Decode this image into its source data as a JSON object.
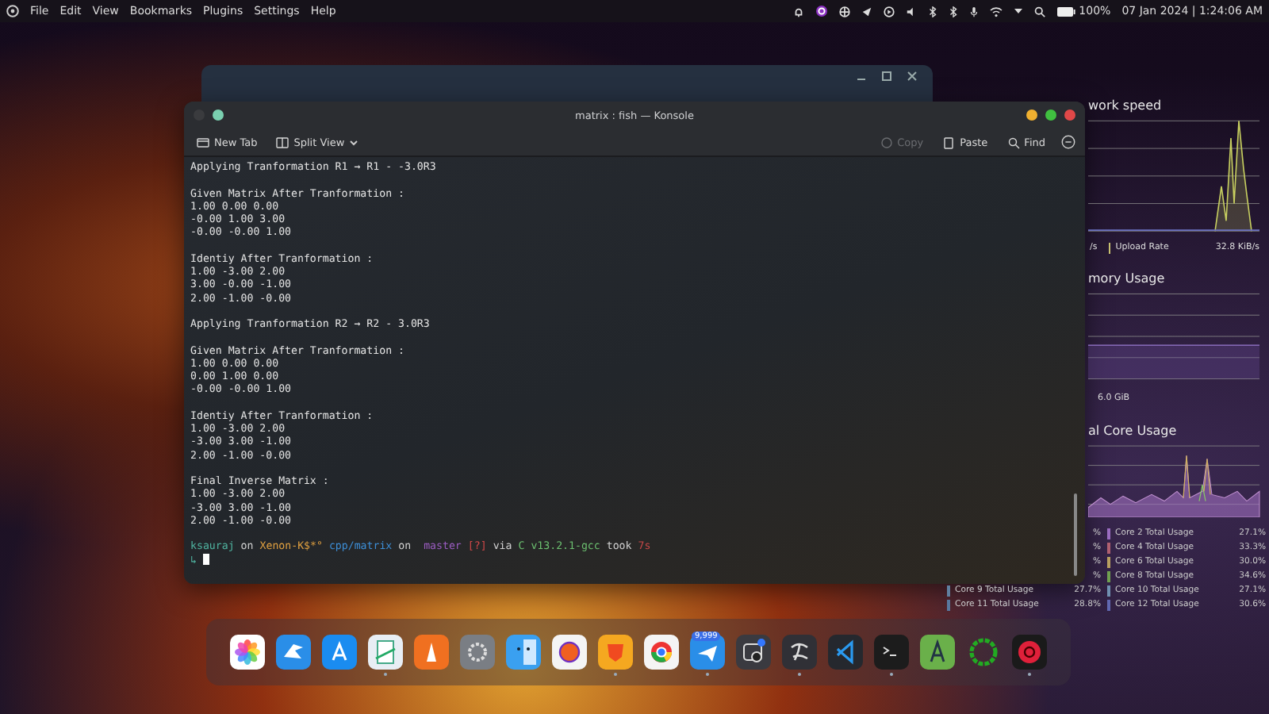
{
  "top_bar": {
    "menus": [
      "File",
      "Edit",
      "View",
      "Bookmarks",
      "Plugins",
      "Settings",
      "Help"
    ],
    "battery": "100%",
    "clock": "07 Jan 2024 | 1:24:06 AM"
  },
  "konsole": {
    "title": "matrix : fish — Konsole",
    "toolbar_left": [
      {
        "label": "New Tab",
        "kind": "tab"
      },
      {
        "label": "Split View",
        "kind": "split"
      }
    ],
    "toolbar_right": [
      {
        "label": "Copy",
        "kind": "copy",
        "disabled": true
      },
      {
        "label": "Paste",
        "kind": "paste",
        "disabled": false
      },
      {
        "label": "Find",
        "kind": "find",
        "disabled": false
      }
    ],
    "output": [
      [
        "Applying Tranformation R1 → R1 - -3.0R3"
      ],
      [
        "Given Matrix After Tranformation :",
        "1.00 0.00 0.00",
        "-0.00 1.00 3.00",
        "-0.00 -0.00 1.00"
      ],
      [
        "Identiy After Tranformation :",
        "1.00 -3.00 2.00",
        "3.00 -0.00 -1.00",
        "2.00 -1.00 -0.00"
      ],
      [
        "Applying Tranformation R2 → R2 - 3.0R3"
      ],
      [
        "Given Matrix After Tranformation :",
        "1.00 0.00 0.00",
        "0.00 1.00 0.00",
        "-0.00 -0.00 1.00"
      ],
      [
        "Identiy After Tranformation :",
        "1.00 -3.00 2.00",
        "-3.00 3.00 -1.00",
        "2.00 -1.00 -0.00"
      ],
      [
        "Final Inverse Matrix :",
        "1.00 -3.00 2.00",
        "-3.00 3.00 -1.00",
        "2.00 -1.00 -0.00"
      ]
    ],
    "prompt": [
      {
        "text": "ksauraj",
        "color": "#4fb3a0"
      },
      {
        "text": "on",
        "color": "#d0d0d0"
      },
      {
        "text": "Xenon-K$*°",
        "color": "#e0a040"
      },
      {
        "text": "cpp/matrix",
        "color": "#3d8fd8"
      },
      {
        "text": "on",
        "color": "#d0d0d0"
      },
      {
        "text": " master",
        "color": "#9a5cc0"
      },
      {
        "text": "[?]",
        "color": "#d04848"
      },
      {
        "text": "via",
        "color": "#d0d0d0"
      },
      {
        "text": "C v13.2.1-gcc",
        "color": "#6cc070"
      },
      {
        "text": "took",
        "color": "#d0d0d0"
      },
      {
        "text": "7s",
        "color": "#c84848"
      }
    ],
    "prompt_arrow": "↳"
  },
  "monitor": {
    "network_title": "work speed",
    "download_rate": "/s",
    "upload_label": "Upload Rate",
    "upload_rate": "32.8 KiB/s",
    "memory_title": "mory Usage",
    "memory_value": "6.0 GiB",
    "core_title": "al Core Usage",
    "cores": [
      [
        {
          "value": "%"
        },
        {
          "name": "Core 2 Total Usage",
          "value": "27.1%",
          "color": "#9a6cc0"
        }
      ],
      [
        {
          "value": "%"
        },
        {
          "name": "Core 4 Total Usage",
          "value": "33.3%",
          "color": "#b06070"
        }
      ],
      [
        {
          "value": "%"
        },
        {
          "name": "Core 6 Total Usage",
          "value": "30.0%",
          "color": "#b8a060"
        }
      ],
      [
        {
          "value": "%"
        },
        {
          "name": "Core 8 Total Usage",
          "value": "34.6%",
          "color": "#70a050"
        }
      ],
      [
        {
          "name": "Core 9 Total Usage",
          "value": "27.7%",
          "color": "#6080a0"
        },
        {
          "name": "Core 10 Total Usage",
          "value": "27.1%",
          "color": "#7090b0"
        }
      ],
      [
        {
          "name": "Core 11 Total Usage",
          "value": "28.8%",
          "color": "#5878a0"
        },
        {
          "name": "Core 12 Total Usage",
          "value": "30.6%",
          "color": "#6068b0"
        }
      ]
    ]
  },
  "dock": [
    {
      "kind": "flower",
      "running": false
    },
    {
      "kind": "bird",
      "running": false
    },
    {
      "kind": "store",
      "running": false
    },
    {
      "kind": "document",
      "running": true
    },
    {
      "kind": "cone",
      "running": false
    },
    {
      "kind": "gear",
      "running": false
    },
    {
      "kind": "face",
      "running": false
    },
    {
      "kind": "fox",
      "running": false
    },
    {
      "kind": "lion",
      "running": true
    },
    {
      "kind": "chrome",
      "running": false
    },
    {
      "kind": "plane",
      "running": true,
      "badge": "9,999"
    },
    {
      "kind": "camera",
      "running": false
    },
    {
      "kind": "obs",
      "running": true
    },
    {
      "kind": "code",
      "running": false
    },
    {
      "kind": "terminal",
      "running": true
    },
    {
      "kind": "android",
      "running": false
    },
    {
      "kind": "ring",
      "running": false
    },
    {
      "kind": "record",
      "running": true
    }
  ]
}
